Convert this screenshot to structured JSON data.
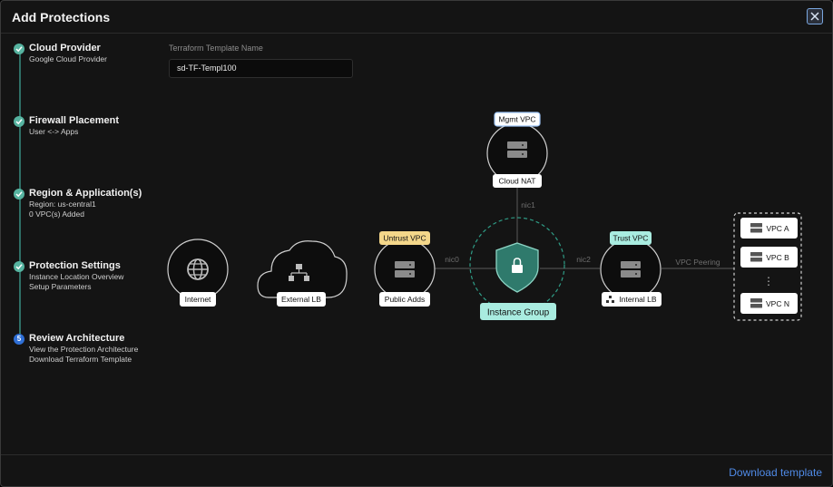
{
  "dialog": {
    "title": "Add Protections",
    "close_icon": "close-icon"
  },
  "steps": [
    {
      "title": "Cloud Provider",
      "lines": [
        "Google Cloud Provider"
      ],
      "state": "complete"
    },
    {
      "title": "Firewall Placement",
      "lines": [
        "User <-> Apps"
      ],
      "state": "complete"
    },
    {
      "title": "Region & Application(s)",
      "lines": [
        "Region: us-central1",
        "0 VPC(s) Added"
      ],
      "state": "complete"
    },
    {
      "title": "Protection Settings",
      "lines": [
        "Instance Location Overview",
        "Setup Parameters"
      ],
      "state": "complete"
    },
    {
      "title": "Review Architecture",
      "number": "5",
      "lines": [
        "View the Protection Architecture",
        "Download Terraform Template"
      ],
      "state": "current"
    }
  ],
  "form": {
    "template_label": "Terraform Template Name",
    "template_value": "sd-TF-Templ100"
  },
  "diagram": {
    "internet": "Internet",
    "external_lb": "External LB",
    "untrust_vpc": "Untrust VPC",
    "public_adds": "Public Adds",
    "mgmt_vpc": "Mgmt VPC",
    "cloud_nat": "Cloud NAT",
    "nic0": "nic0",
    "nic1": "nic1",
    "nic2": "nic2",
    "instance_group": "Instance Group",
    "trust_vpc": "Trust VPC",
    "internal_lb": "Internal LB",
    "vpc_peering": "VPC Peering",
    "vpcs": [
      "VPC A",
      "VPC B",
      "VPC N"
    ],
    "ellipsis": "⋮"
  },
  "footer": {
    "download": "Download template"
  },
  "colors": {
    "accent": "#56b3a0",
    "link": "#4f8ae6",
    "untrust": "#f4d78a",
    "trust": "#a9ece0",
    "mgmt": "#9cc3f5"
  }
}
